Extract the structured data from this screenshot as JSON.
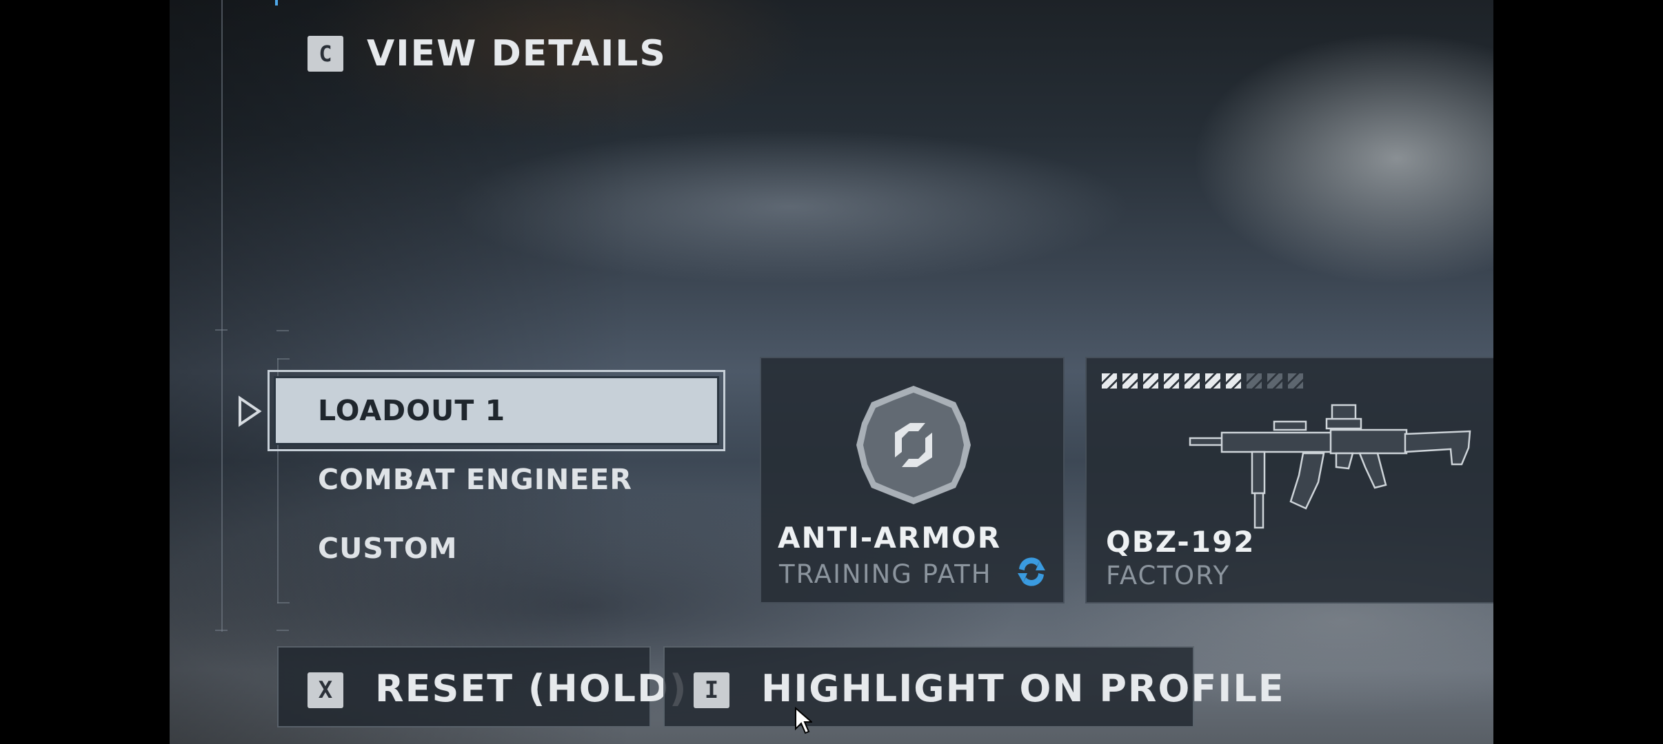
{
  "top_action": {
    "key": "C",
    "label": "VIEW DETAILS"
  },
  "loadouts": [
    {
      "label": "LOADOUT 1",
      "selected": true
    },
    {
      "label": "COMBAT ENGINEER",
      "selected": false
    },
    {
      "label": "CUSTOM",
      "selected": false
    }
  ],
  "training_card": {
    "title": "ANTI-ARMOR",
    "subtitle": "TRAINING PATH",
    "emblem_icon": "training-path-emblem-icon",
    "badge_icon": "refresh-cycle-icon",
    "accent": "#3a9be0"
  },
  "weapon_card": {
    "title": "QBZ-192",
    "subtitle": "FACTORY",
    "icon": "assault-rifle-icon",
    "progress": {
      "filled": 7,
      "total": 10
    }
  },
  "buttons": [
    {
      "key": "X",
      "label": "RESET (HOLD)"
    },
    {
      "key": "I",
      "label": "HIGHLIGHT ON PROFILE"
    }
  ],
  "colors": {
    "selected_bg": "#c7d0d8",
    "text": "#e6e9ec",
    "muted": "#8c959e"
  }
}
